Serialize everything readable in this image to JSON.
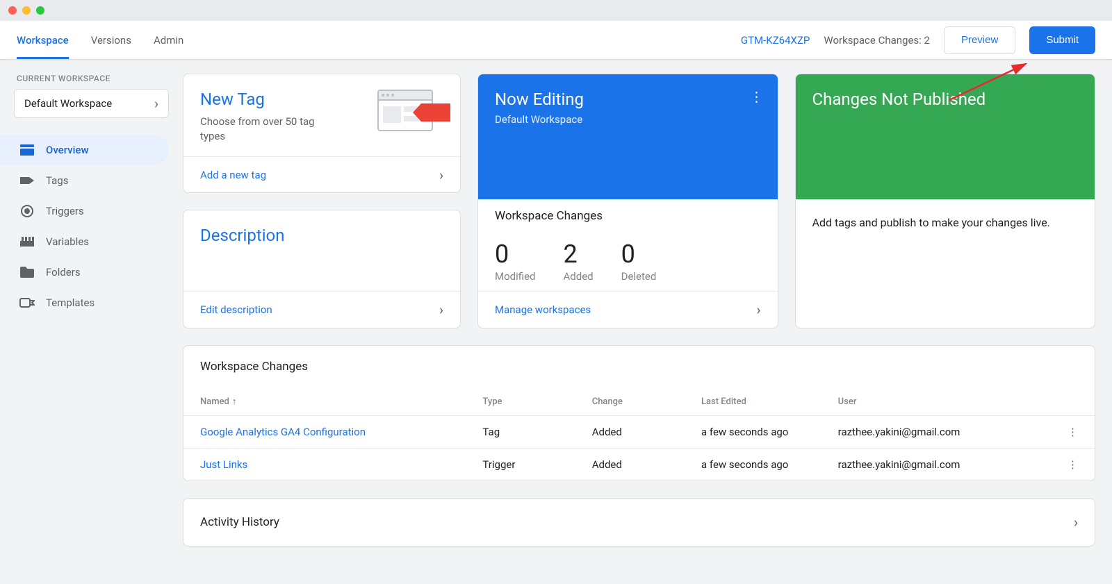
{
  "header": {
    "tabs": [
      "Workspace",
      "Versions",
      "Admin"
    ],
    "container_id": "GTM-KZ64XZP",
    "changes_label": "Workspace Changes: 2",
    "preview_label": "Preview",
    "submit_label": "Submit"
  },
  "sidebar": {
    "heading": "CURRENT WORKSPACE",
    "workspace": "Default Workspace",
    "items": [
      {
        "label": "Overview"
      },
      {
        "label": "Tags"
      },
      {
        "label": "Triggers"
      },
      {
        "label": "Variables"
      },
      {
        "label": "Folders"
      },
      {
        "label": "Templates"
      }
    ]
  },
  "cards": {
    "newtag": {
      "title": "New Tag",
      "subtitle": "Choose from over 50 tag types",
      "action": "Add a new tag"
    },
    "description": {
      "title": "Description",
      "action": "Edit description"
    },
    "editing": {
      "title": "Now Editing",
      "subtitle": "Default Workspace",
      "stats_title": "Workspace Changes",
      "stats": [
        {
          "num": "0",
          "label": "Modified"
        },
        {
          "num": "2",
          "label": "Added"
        },
        {
          "num": "0",
          "label": "Deleted"
        }
      ],
      "action": "Manage workspaces"
    },
    "publish": {
      "title": "Changes Not Published",
      "body": "Add tags and publish to make your changes live."
    }
  },
  "changes_table": {
    "title": "Workspace Changes",
    "cols": {
      "name": "Named",
      "type": "Type",
      "change": "Change",
      "edited": "Last Edited",
      "user": "User"
    },
    "rows": [
      {
        "name": "Google Analytics GA4 Configuration",
        "type": "Tag",
        "change": "Added",
        "edited": "a few seconds ago",
        "user": "razthee.yakini@gmail.com"
      },
      {
        "name": "Just Links",
        "type": "Trigger",
        "change": "Added",
        "edited": "a few seconds ago",
        "user": "razthee.yakini@gmail.com"
      }
    ]
  },
  "activity": {
    "title": "Activity History"
  }
}
